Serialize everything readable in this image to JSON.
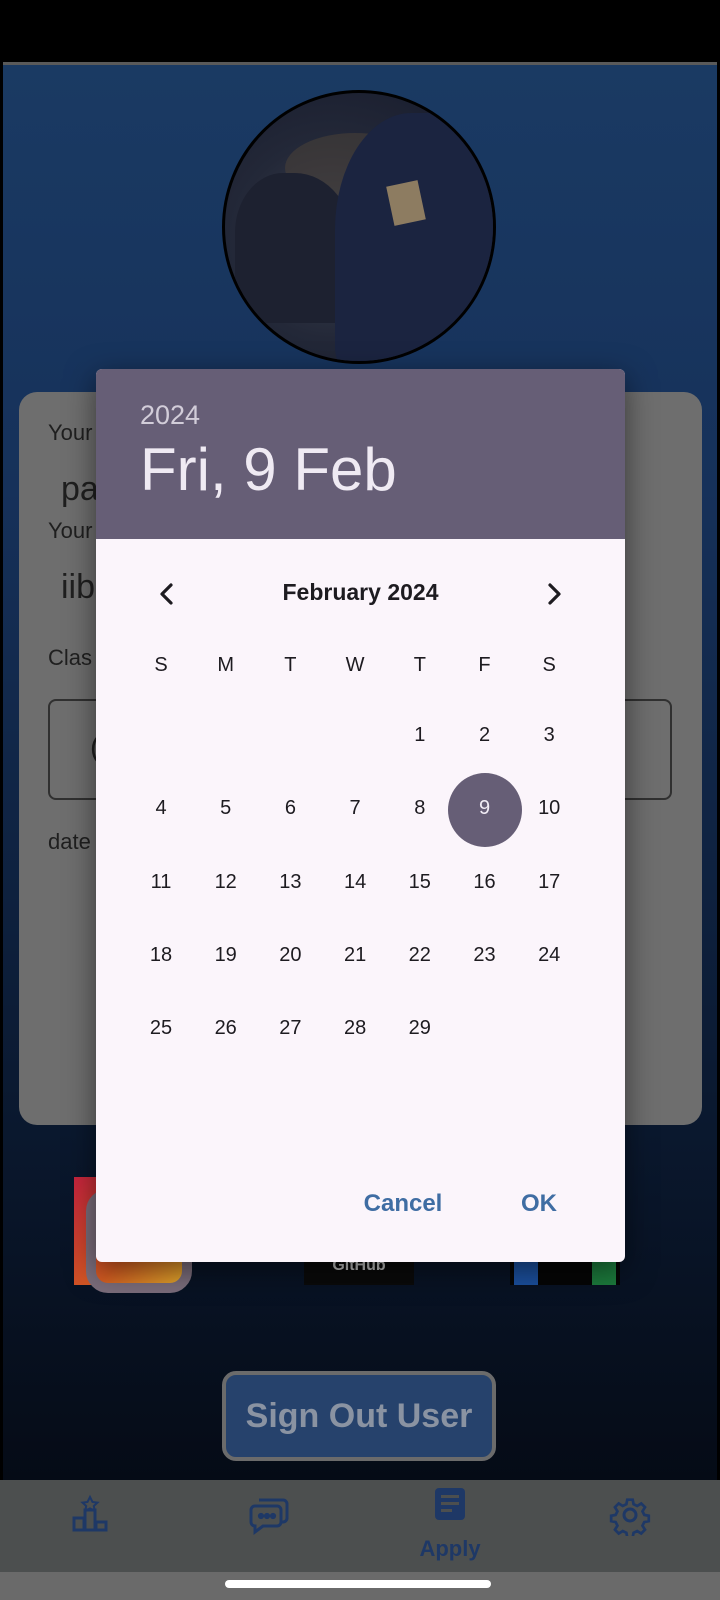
{
  "profile": {
    "labels": [
      "Your",
      "Your",
      "Clas",
      "date"
    ],
    "name_value": "pa",
    "email_value": "iib",
    "class_value": "("
  },
  "socials": {
    "github_label": "GitHub"
  },
  "sign_out_label": "Sign Out User",
  "bottom_nav": {
    "items": [
      {
        "icon": "leaderboard-icon",
        "label": ""
      },
      {
        "icon": "chat-icon",
        "label": ""
      },
      {
        "icon": "apply-icon",
        "label": "Apply"
      },
      {
        "icon": "gear-icon",
        "label": ""
      }
    ]
  },
  "date_picker": {
    "year": "2024",
    "selected_date": "Fri, 9 Feb",
    "month_label": "February 2024",
    "weekdays": [
      "S",
      "M",
      "T",
      "W",
      "T",
      "F",
      "S"
    ],
    "first_weekday_index": 4,
    "days_in_month": 29,
    "selected_day": 9,
    "cancel_label": "Cancel",
    "ok_label": "OK"
  },
  "colors": {
    "header_bg": "#665e76",
    "selected_bg": "#665e76",
    "button_text": "#3f6da3",
    "dialog_bg": "#fbf5fb"
  }
}
